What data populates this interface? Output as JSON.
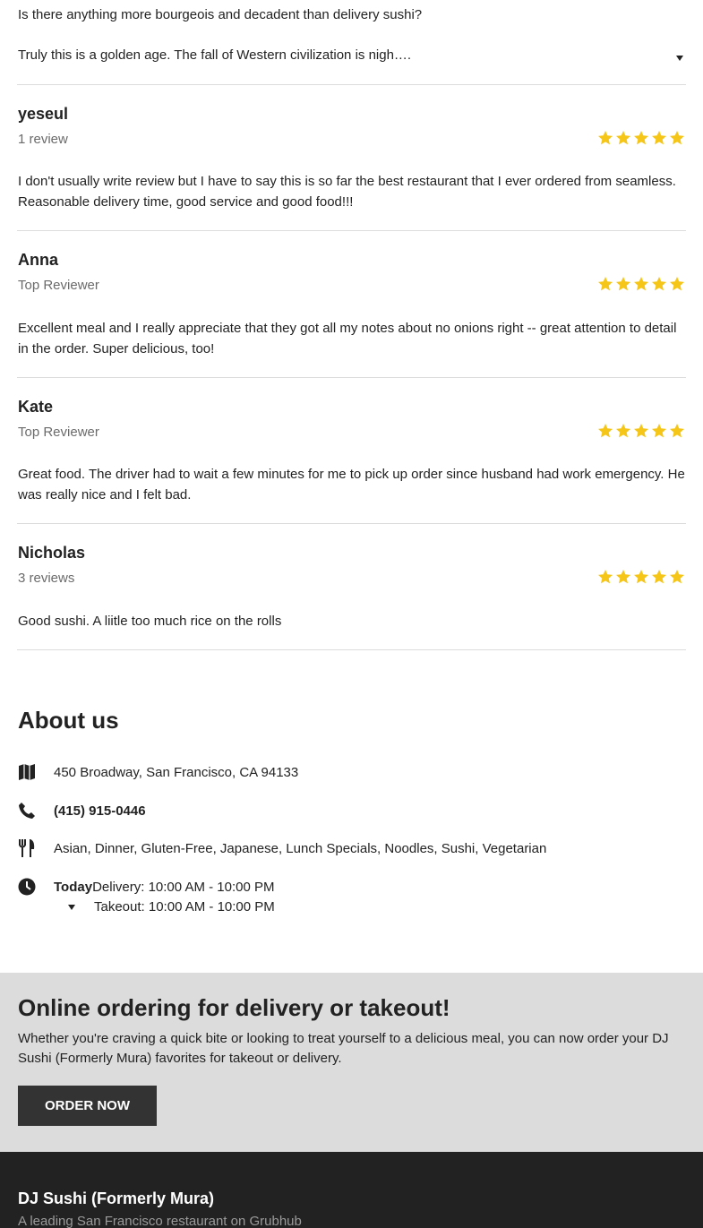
{
  "truncated_review": {
    "line1": "Is there anything more bourgeois and decadent than delivery sushi?",
    "line2": "Truly this is a golden age. The fall of Western civilization is nigh…."
  },
  "reviews": [
    {
      "name": "yeseul",
      "meta": "1 review",
      "rating": 5,
      "text": "I don't usually write review but I have to say this is so far the best restaurant that I ever ordered from seamless. Reasonable delivery time, good service and good food!!!"
    },
    {
      "name": "Anna",
      "meta": "Top Reviewer",
      "rating": 5,
      "text": "Excellent meal and I really appreciate that they got all my notes about no onions right -- great attention to detail in the order. Super delicious, too!"
    },
    {
      "name": "Kate",
      "meta": "Top Reviewer",
      "rating": 5,
      "text": "Great food. The driver had to wait a few minutes for me to pick up order since husband had work emergency. He was really nice and I felt bad."
    },
    {
      "name": "Nicholas",
      "meta": "3 reviews",
      "rating": 5,
      "text": "Good sushi. A liitle too much rice on the rolls"
    }
  ],
  "about": {
    "title": "About us",
    "address": "450 Broadway, San Francisco, CA 94133",
    "phone": "(415) 915-0446",
    "cuisines": "Asian, Dinner, Gluten-Free, Japanese, Lunch Specials, Noodles, Sushi, Vegetarian",
    "hours": {
      "today_label": "Today",
      "delivery": "Delivery: 10:00 AM - 10:00 PM",
      "takeout": "Takeout: 10:00 AM - 10:00 PM"
    },
    "icons": [
      "map-icon",
      "phone-icon",
      "utensils-icon",
      "clock-icon"
    ]
  },
  "promo": {
    "title": "Online ordering for delivery or takeout!",
    "description": "Whether you're craving a quick bite or looking to treat yourself to a delicious meal, you can now order your DJ Sushi (Formerly Mura) favorites for takeout or delivery.",
    "button_label": "ORDER NOW"
  },
  "footer": {
    "restaurant_name": "DJ Sushi (Formerly Mura)",
    "tagline": "A leading San Francisco restaurant on Grubhub"
  },
  "colors": {
    "star": "#f5c518",
    "promo_bg": "#dcdcdc",
    "button_bg": "#333333",
    "footer_bg": "#222222"
  }
}
